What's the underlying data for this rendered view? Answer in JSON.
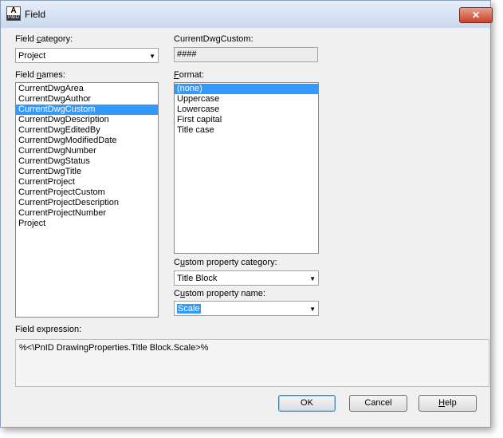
{
  "window": {
    "title": "Field",
    "icon_text_top": "A",
    "icon_text_bottom": "P&ID"
  },
  "field_category": {
    "label_pre": "Field ",
    "label_u": "c",
    "label_post": "ategory:",
    "value": "Project"
  },
  "preview": {
    "label": "CurrentDwgCustom:",
    "value": "####"
  },
  "field_names": {
    "label_pre": "Field ",
    "label_u": "n",
    "label_post": "ames:",
    "items": [
      "CurrentDwgArea",
      "CurrentDwgAuthor",
      "CurrentDwgCustom",
      "CurrentDwgDescription",
      "CurrentDwgEditedBy",
      "CurrentDwgModifiedDate",
      "CurrentDwgNumber",
      "CurrentDwgStatus",
      "CurrentDwgTitle",
      "CurrentProject",
      "CurrentProjectCustom",
      "CurrentProjectDescription",
      "CurrentProjectNumber",
      "Project"
    ],
    "selected_index": 2
  },
  "format": {
    "label_u": "F",
    "label_post": "ormat:",
    "items": [
      "(none)",
      "Uppercase",
      "Lowercase",
      "First capital",
      "Title case"
    ],
    "selected_index": 0
  },
  "custom_category": {
    "label_pre": "C",
    "label_u": "u",
    "label_post": "stom property category:",
    "value": "Title Block"
  },
  "custom_name": {
    "label_pre": "C",
    "label_u": "u",
    "label_post": "stom property name:",
    "value": "Scale"
  },
  "expression": {
    "label": "Field expression:",
    "value": "%<\\PnID DrawingProperties.Title Block.Scale>%"
  },
  "buttons": {
    "ok": "OK",
    "cancel": "Cancel",
    "help_u": "H",
    "help_post": "elp"
  }
}
